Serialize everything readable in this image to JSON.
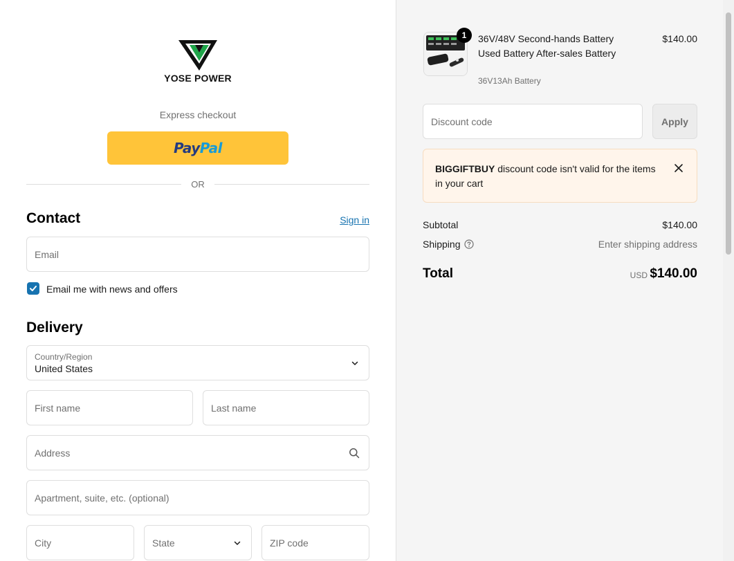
{
  "brand": {
    "name": "YOSE POWER"
  },
  "express": {
    "label": "Express checkout",
    "paypal_a": "Pay",
    "paypal_b": "Pal"
  },
  "divider": {
    "or": "OR"
  },
  "contact": {
    "title": "Contact",
    "sign_in": "Sign in",
    "email_placeholder": "Email",
    "news_checkbox_label": "Email me with news and offers",
    "news_checked": true
  },
  "delivery": {
    "title": "Delivery",
    "country_label": "Country/Region",
    "country_value": "United States",
    "first_name_placeholder": "First name",
    "last_name_placeholder": "Last name",
    "address_placeholder": "Address",
    "apartment_placeholder": "Apartment, suite, etc. (optional)",
    "city_placeholder": "City",
    "state_placeholder": "State",
    "zip_placeholder": "ZIP code"
  },
  "cart": {
    "item": {
      "quantity": "1",
      "name": "36V/48V Second-hands Battery Used Battery After-sales Battery",
      "variant": "36V13Ah Battery",
      "price": "$140.00"
    },
    "discount_placeholder": "Discount code",
    "apply_label": "Apply",
    "notice_code": "BIGGIFTBUY",
    "notice_message": " discount code isn't valid for the items in your cart",
    "subtotal_label": "Subtotal",
    "subtotal_value": "$140.00",
    "shipping_label": "Shipping",
    "shipping_value": "Enter shipping address",
    "total_label": "Total",
    "total_currency": "USD",
    "total_value": "$140.00"
  },
  "colors": {
    "accent": "#1773b0",
    "paypal_yellow": "#ffc439",
    "notice_bg": "#fff5eb",
    "brand_green": "#1fa64a"
  }
}
